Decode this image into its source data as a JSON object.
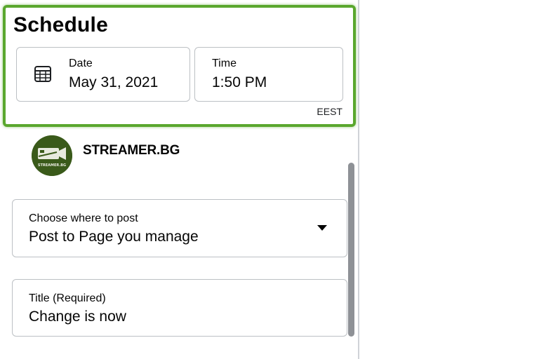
{
  "schedule": {
    "title": "Schedule",
    "date": {
      "label": "Date",
      "value": "May 31, 2021",
      "icon": "calendar-icon"
    },
    "time": {
      "label": "Time",
      "value": "1:50 PM"
    },
    "timezone": "EEST"
  },
  "page": {
    "name": "STREAMER.BG",
    "avatar_text": "STREAMER.BG",
    "avatar_color": "#3a5a1a"
  },
  "post_destination": {
    "label": "Choose where to post",
    "value": "Post to Page you manage",
    "icon": "chevron-down-icon"
  },
  "title_field": {
    "label": "Title (Required)",
    "value": "Change is now"
  },
  "colors": {
    "highlight": "#5aa72e",
    "border": "#bcc0c4",
    "scrollbar": "#8e9196"
  }
}
